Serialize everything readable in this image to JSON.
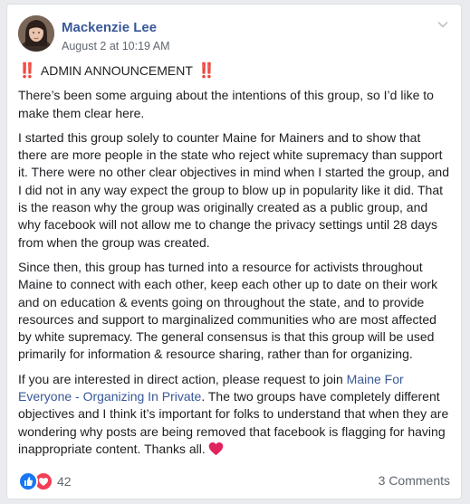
{
  "post": {
    "author": "Mackenzie Lee",
    "timestamp": "August 2 at 10:19 AM",
    "announcement_marker": "‼️",
    "announcement_title": "ADMIN ANNOUNCEMENT",
    "paragraph_1": "There’s been some arguing about the intentions of this group, so I’d like to make them clear here.",
    "paragraph_2": "I started this group solely to counter Maine for Mainers and to show that there are more people in the state who reject white supremacy than support it. There were no other clear objectives in mind when I started the group, and I did not in any way expect the group to blow up in popularity like it did. That is the reason why the group was originally created as a public group, and why facebook will not allow me to change the privacy settings until 28 days from when the group was created.",
    "paragraph_3": "Since then, this group has turned into a resource for activists throughout Maine to connect with each other, keep each other up to date on their work and on education & events going on throughout the state, and to provide resources and support to marginalized communities who are most affected by white supremacy. The general consensus is that this group will be used primarily for information & resource sharing, rather than for organizing.",
    "paragraph_4_before_link": "If you are interested in direct action, please request to join ",
    "paragraph_4_link": "Maine For Everyone - Organizing In Private",
    "paragraph_4_after_link": ". The two groups have completely different objectives and I think it’s important for folks to understand that when they are wondering why posts are being removed that facebook is flagging for having inappropriate content. Thanks all.",
    "reactions_count": "42",
    "comments_count": "3 Comments"
  },
  "icons": {
    "menu": "chevron-down-icon",
    "like": "like-reaction-icon",
    "love": "love-reaction-icon",
    "heart": "red-heart-icon"
  },
  "colors": {
    "link": "#385898",
    "like_blue": "#1877f2",
    "love_red": "#f33e58",
    "heart_red": "#e0245e",
    "muted_text": "#606770"
  }
}
